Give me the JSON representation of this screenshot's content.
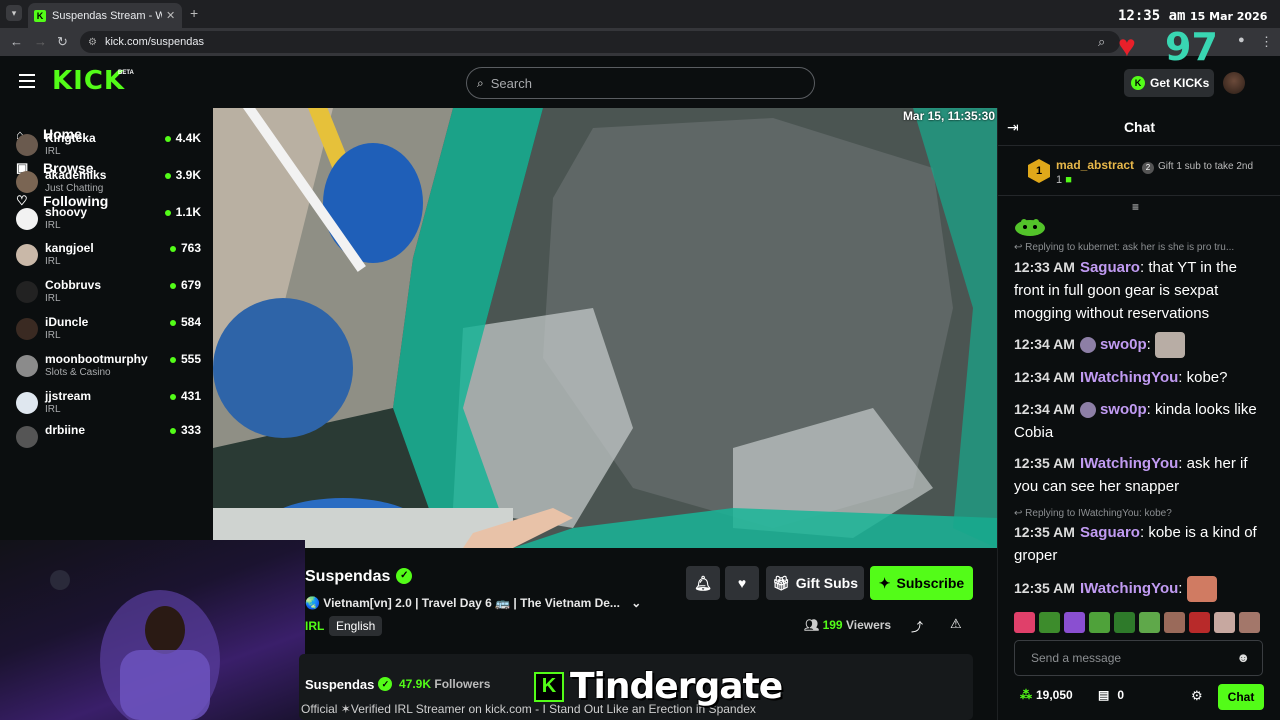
{
  "browser": {
    "tab_title": "Suspendas Stream - Watch",
    "url": "kick.com/suspendas",
    "clock_time": "12:35 am",
    "clock_date": "15 Mar 2026"
  },
  "overlay": {
    "heart_count": "97",
    "bottom_banner": "Tindergate"
  },
  "header": {
    "logo": "KICK",
    "logo_badge": "BETA",
    "search_placeholder": "Search",
    "get_kicks_label": "Get KICKs"
  },
  "sidebar": {
    "nav": [
      {
        "label": "Home",
        "icon": "home-icon"
      },
      {
        "label": "Browse",
        "icon": "browse-icon"
      },
      {
        "label": "Following",
        "icon": "heart-icon"
      }
    ],
    "channels": [
      {
        "name": "Kingteka",
        "category": "IRL",
        "viewers": "4.4K",
        "color": "#6a5a4e"
      },
      {
        "name": "akademiks",
        "category": "Just Chatting",
        "viewers": "3.9K",
        "color": "#7a6553"
      },
      {
        "name": "shoovy",
        "category": "IRL",
        "viewers": "1.1K",
        "color": "#f2f2f2"
      },
      {
        "name": "kangjoel",
        "category": "IRL",
        "viewers": "763",
        "color": "#c9b8a8"
      },
      {
        "name": "Cobbruvs",
        "category": "IRL",
        "viewers": "679",
        "color": "#222222"
      },
      {
        "name": "iDuncle",
        "category": "IRL",
        "viewers": "584",
        "color": "#3a2a22"
      },
      {
        "name": "moonbootmurphy",
        "category": "Slots & Casino",
        "viewers": "555",
        "color": "#8b8b8b"
      },
      {
        "name": "jjstream",
        "category": "IRL",
        "viewers": "431",
        "color": "#dfe7ef"
      },
      {
        "name": "drbiine",
        "category": "",
        "viewers": "333",
        "color": "#555555"
      }
    ]
  },
  "video": {
    "timestamp": "Mar 15, 11:35:30"
  },
  "stream": {
    "streamer": "Suspendas",
    "title": "🌏 Vietnam[vn] 2.0 | Travel Day 6 🚌 | The Vietnam De...",
    "category": "IRL",
    "language": "English",
    "gift_subs_label": "Gift Subs",
    "subscribe_label": "Subscribe",
    "viewer_count": "199",
    "viewers_label": "Viewers",
    "about_name": "Suspendas",
    "followers_count": "47.9K",
    "followers_label": "Followers",
    "description": "Official ✶Verified IRL Streamer on kick.com - I Stand Out Like an Erection in Spandex"
  },
  "chat": {
    "title": "Chat",
    "pinned": {
      "rank": "1",
      "user": "mad_abstract",
      "count": "1",
      "gift_text": "Gift 1 sub to take 2nd"
    },
    "reply1": "Replying to kubernet: ask her is she is pro tru...",
    "reply2": "Replying to IWatchingYou: kobe?",
    "messages": [
      {
        "time": "12:33 AM",
        "user": "Saguaro",
        "color": "#c19bf2",
        "text": "that YT in the front in full goon gear is sexpat mogging without reservations"
      },
      {
        "time": "12:34 AM",
        "user": "swo0p",
        "color": "#c19bf2",
        "text": ""
      },
      {
        "time": "12:34 AM",
        "user": "IWatchingYou",
        "color": "#c19bf2",
        "text": "kobe?"
      },
      {
        "time": "12:34 AM",
        "user": "swo0p",
        "color": "#c19bf2",
        "text": "kinda looks like Cobia"
      },
      {
        "time": "12:35 AM",
        "user": "IWatchingYou",
        "color": "#c19bf2",
        "text": "ask her if you can see her snapper"
      },
      {
        "time": "12:35 AM",
        "user": "Saguaro",
        "color": "#c19bf2",
        "text": "kobe is a kind of groper"
      },
      {
        "time": "12:35 AM",
        "user": "IWatchingYou",
        "color": "#c19bf2",
        "text": ""
      }
    ],
    "input_placeholder": "Send a message",
    "points": "19,050",
    "gifts": "0",
    "send_label": "Chat"
  }
}
